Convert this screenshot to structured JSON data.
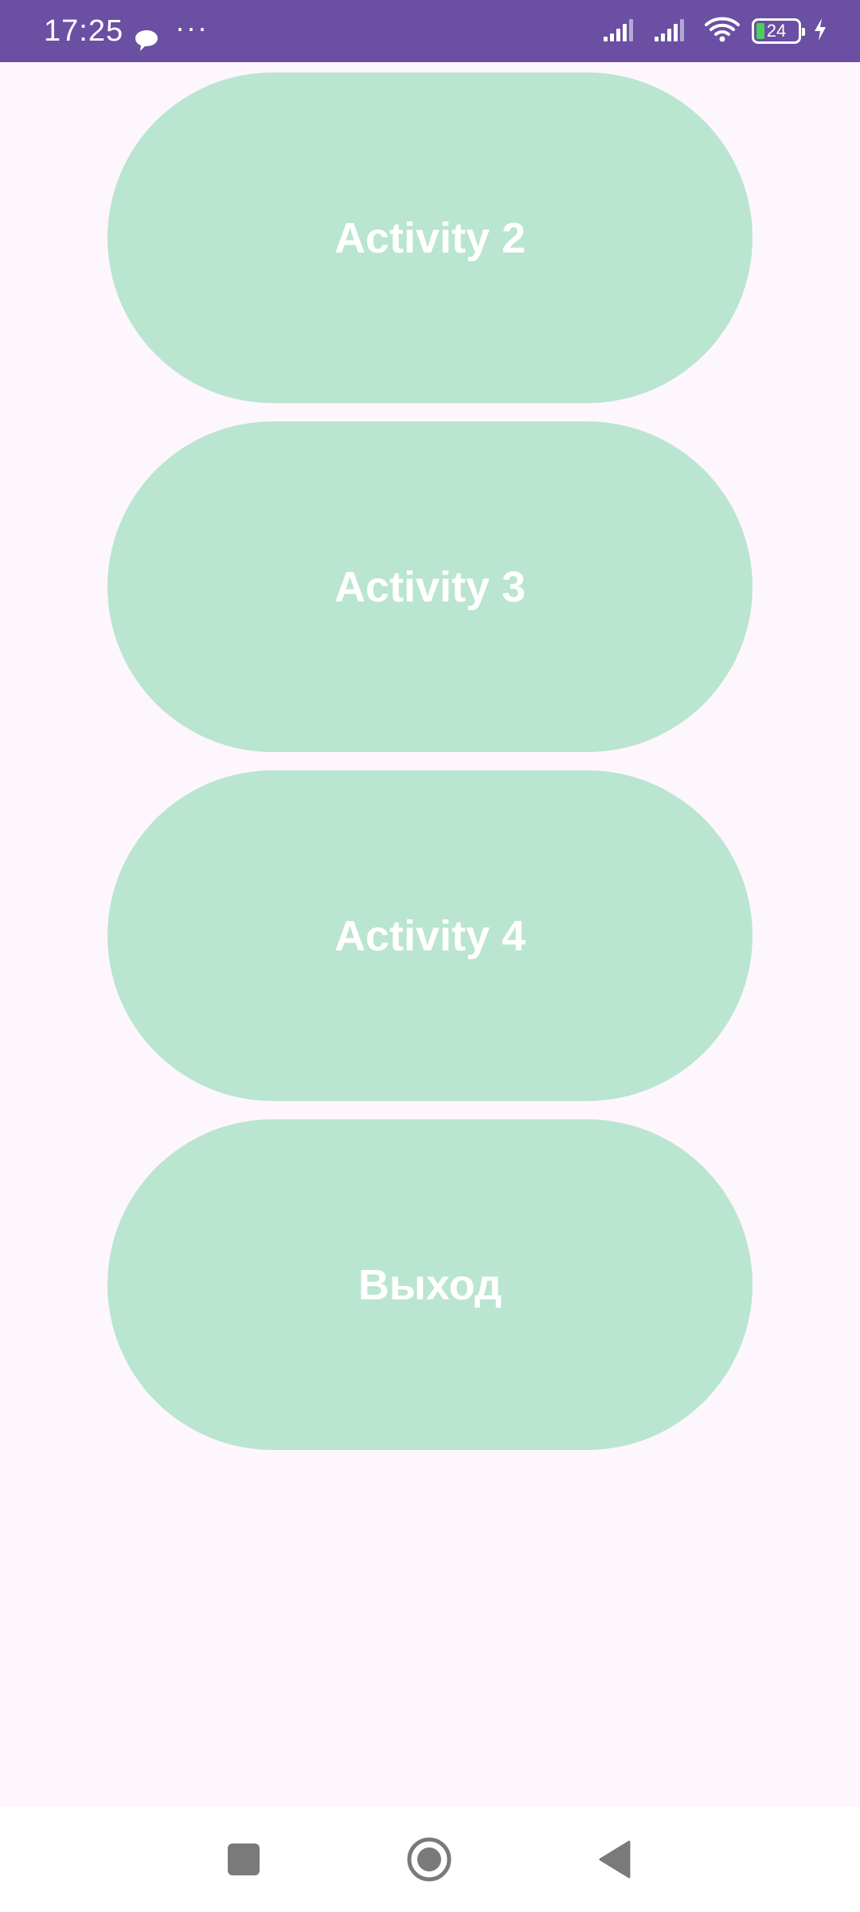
{
  "status_bar": {
    "time": "17:25",
    "more_indicator": "···",
    "battery_level": "24",
    "icons": [
      "message-bubble-icon",
      "signal-icon",
      "signal-icon",
      "wifi-icon",
      "battery-icon",
      "charging-icon"
    ],
    "background_color": "#6A4FA3"
  },
  "main": {
    "buttons": [
      {
        "label": "Activity 2"
      },
      {
        "label": "Activity 3"
      },
      {
        "label": "Activity 4"
      },
      {
        "label": "Выход"
      }
    ],
    "button_color": "#BAE5D0",
    "button_text_color": "#FFFFFF",
    "background_color": "#FDF6FD"
  },
  "nav_bar": {
    "icons": [
      "recent-apps-icon",
      "home-icon",
      "back-icon"
    ]
  }
}
